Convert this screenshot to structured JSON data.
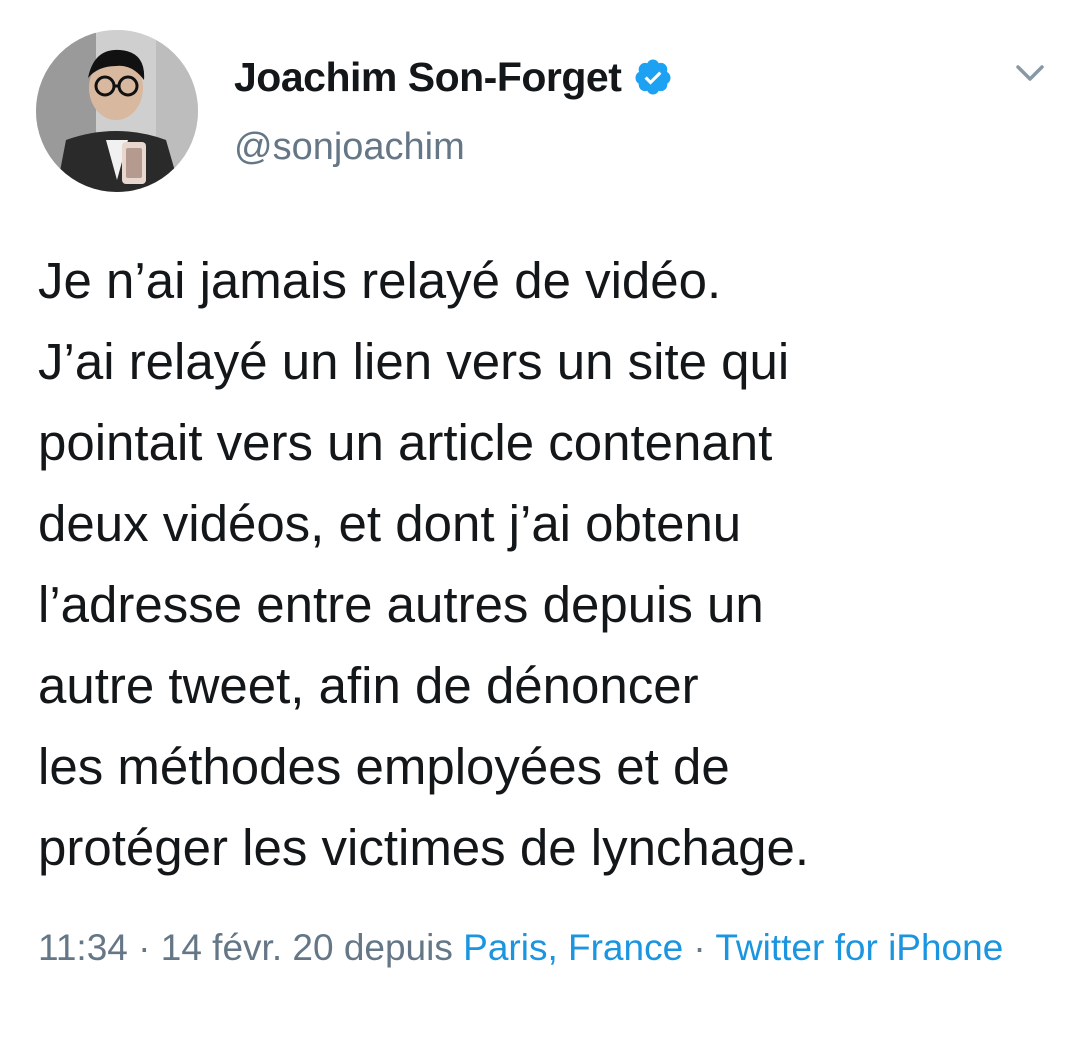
{
  "author": {
    "display_name": "Joachim Son-Forget",
    "handle": "@sonjoachim",
    "verified": true,
    "avatar_icon": "profile-photo"
  },
  "menu": {
    "icon": "chevron-down-icon"
  },
  "tweet": {
    "lines": [
      "Je n’ai jamais relayé de vidéo.",
      "J’ai relayé un lien vers un site qui",
      "pointait vers un article contenant",
      "deux vidéos, et dont j’ai obtenu",
      "l’adresse entre autres depuis un",
      "autre tweet, afin de dénoncer",
      "les méthodes employées et de",
      "protéger les victimes de lynchage."
    ]
  },
  "meta": {
    "time": "11:34",
    "separator1": " · ",
    "date": "14 févr. 20",
    "source_prefix": " depuis ",
    "location": "Paris, France",
    "separator2": " · ",
    "client": "Twitter for iPhone"
  },
  "colors": {
    "text": "#14171a",
    "secondary": "#657786",
    "link": "#1b95e0",
    "verified": "#1da1f2"
  }
}
